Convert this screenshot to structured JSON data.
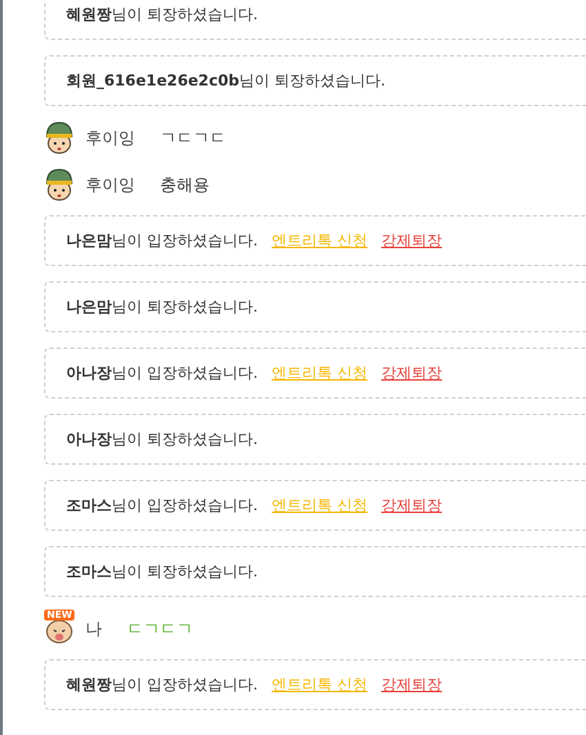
{
  "feed": [
    {
      "kind": "notice",
      "name": "혜원짱",
      "text": "님이 퇴장하셨습니다."
    },
    {
      "kind": "notice",
      "name": "회원_616e1e26e2c0b",
      "text": "님이 퇴장하셨습니다."
    },
    {
      "kind": "chat",
      "avatar": {
        "kind": "helmet"
      },
      "name": "후이잉",
      "message": "ㄱㄷㄱㄷ",
      "color": "#333333"
    },
    {
      "kind": "chat",
      "avatar": {
        "kind": "helmet"
      },
      "name": "후이잉",
      "message": "충해용",
      "color": "#333333"
    },
    {
      "kind": "notice",
      "name": "나은맘",
      "text": "님이 입장하셨습니다.",
      "actions": [
        {
          "label": "엔트리톡 신청",
          "color": "#f5b700"
        },
        {
          "label": "강제퇴장",
          "color": "#e8403a"
        }
      ]
    },
    {
      "kind": "notice",
      "name": "나은맘",
      "text": "님이 퇴장하셨습니다."
    },
    {
      "kind": "notice",
      "name": "아나장",
      "text": "님이 입장하셨습니다.",
      "actions": [
        {
          "label": "엔트리톡 신청",
          "color": "#f5b700"
        },
        {
          "label": "강제퇴장",
          "color": "#e8403a"
        }
      ]
    },
    {
      "kind": "notice",
      "name": "아나장",
      "text": "님이 퇴장하셨습니다."
    },
    {
      "kind": "notice",
      "name": "조마스",
      "text": "님이 입장하셨습니다.",
      "actions": [
        {
          "label": "엔트리톡 신청",
          "color": "#f5b700"
        },
        {
          "label": "강제퇴장",
          "color": "#e8403a"
        }
      ]
    },
    {
      "kind": "notice",
      "name": "조마스",
      "text": "님이 퇴장하셨습니다."
    },
    {
      "kind": "chat",
      "avatar": {
        "kind": "baby",
        "badge": "NEW"
      },
      "name": "나",
      "message": "ㄷㄱㄷㄱ",
      "color": "#4caa1e"
    },
    {
      "kind": "notice",
      "name": "혜원짱",
      "text": "님이 입장하셨습니다.",
      "actions": [
        {
          "label": "엔트리톡 신청",
          "color": "#f5b700"
        },
        {
          "label": "강제퇴장",
          "color": "#e8403a"
        }
      ]
    }
  ]
}
